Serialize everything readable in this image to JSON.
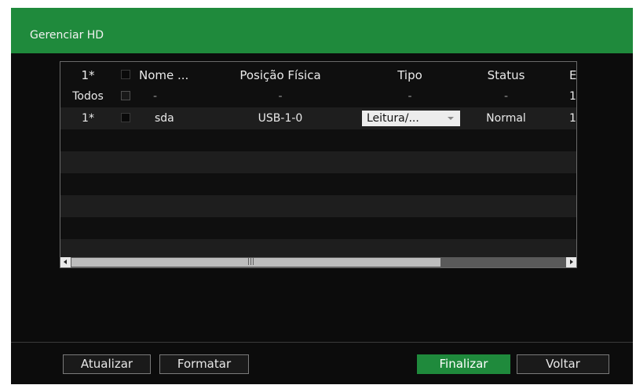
{
  "window": {
    "title": "Gerenciar HD"
  },
  "colors": {
    "accent": "#1f8a3c",
    "background": "#0c0c0c",
    "row_shade": "#1e1e1e"
  },
  "table": {
    "columns": {
      "num": "1*",
      "name": "Nome ...",
      "position": "Posição Física",
      "type": "Tipo",
      "status": "Status",
      "last": "E"
    },
    "all_row": {
      "label": "Todos",
      "name": "-",
      "position": "-",
      "type": "-",
      "status": "-",
      "last": "1"
    },
    "rows": [
      {
        "num": "1*",
        "name": "sda",
        "position": "USB-1-0",
        "type": "Leitura/...",
        "status": "Normal",
        "last": "1"
      }
    ],
    "scrollbar_grip": "|||"
  },
  "buttons": {
    "refresh": "Atualizar",
    "format": "Formatar",
    "finish": "Finalizar",
    "back": "Voltar"
  }
}
